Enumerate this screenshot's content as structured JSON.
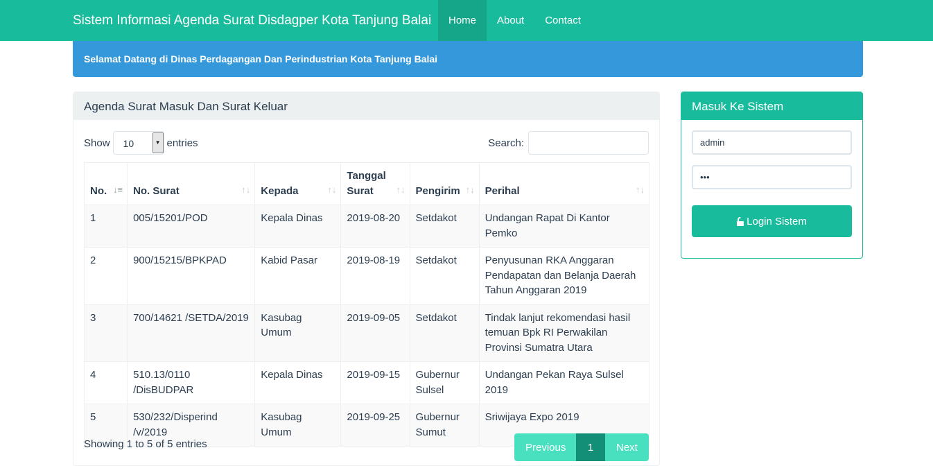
{
  "navbar": {
    "brand": "Sistem Informasi Agenda Surat Disdagper Kota Tanjung Balai",
    "links": [
      "Home",
      "About",
      "Contact"
    ],
    "active": "Home"
  },
  "alert": {
    "text": "Selamat Datang di Dinas Perdagangan Dan Perindustrian Kota Tanjung Balai"
  },
  "agenda": {
    "title": "Agenda Surat Masuk Dan Surat Keluar",
    "show_label": "Show",
    "entries_label": "entries",
    "page_length": "10",
    "search_label": "Search:",
    "search_value": "",
    "columns": [
      "No.",
      "No. Surat",
      "Kepada",
      "Tanggal Surat",
      "Pengirim",
      "Perihal"
    ],
    "rows": [
      [
        "1",
        "005/15201/POD",
        "Kepala Dinas",
        "2019-08-20",
        "Setdakot",
        "Undangan Rapat Di Kantor Pemko"
      ],
      [
        "2",
        "900/15215/BPKPAD",
        "Kabid Pasar",
        "2019-08-19",
        "Setdakot",
        "Penyusunan RKA Anggaran Pendapatan dan Belanja Daerah Tahun Anggaran 2019"
      ],
      [
        "3",
        "700/14621 /SETDA/2019",
        "Kasubag Umum",
        "2019-09-05",
        "Setdakot",
        "Tindak lanjut rekomendasi hasil temuan Bpk RI Perwakilan Provinsi Sumatra Utara"
      ],
      [
        "4",
        "510.13/0110 /DisBUDPAR",
        "Kepala Dinas",
        "2019-09-15",
        "Gubernur Sulsel",
        "Undangan Pekan Raya Sulsel 2019"
      ],
      [
        "5",
        "530/232/Disperind /v/2019",
        "Kasubag Umum",
        "2019-09-25",
        "Gubernur Sumut",
        "Sriwijaya Expo 2019"
      ]
    ],
    "info": "Showing 1 to 5 of 5 entries",
    "pagination": {
      "previous": "Previous",
      "current": "1",
      "next": "Next"
    }
  },
  "login": {
    "title": "Masuk Ke Sistem",
    "username": "admin",
    "password": "abc",
    "button_label": "Login Sistem",
    "button_icon": "unlock-icon"
  },
  "colors": {
    "primary": "#18bc9c",
    "info": "#3498db",
    "text": "#2c3e50",
    "panel_heading": "#ecf0f1"
  }
}
